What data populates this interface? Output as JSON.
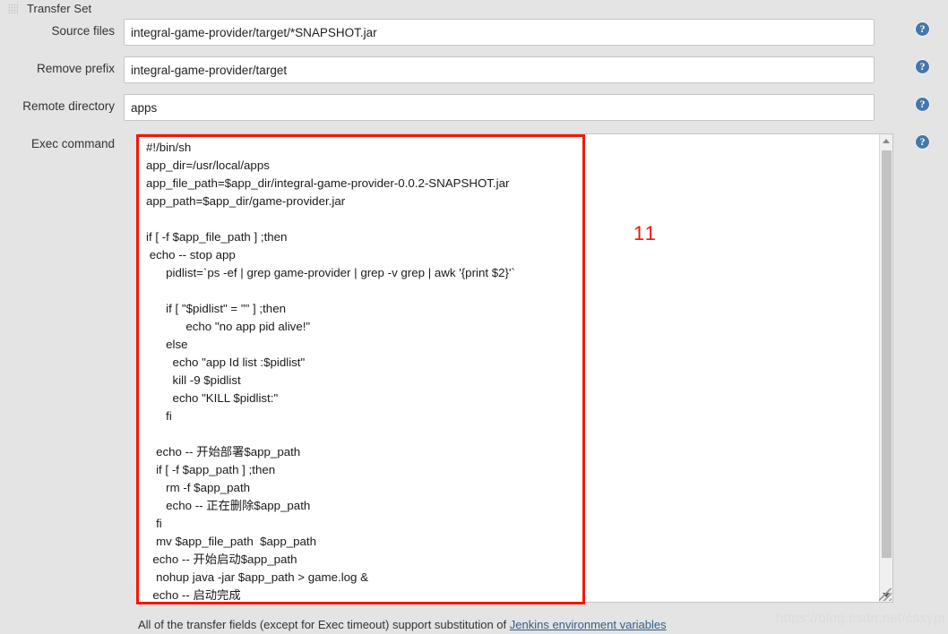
{
  "panel": {
    "title": "Transfer Set",
    "grip_icon": "drag-grip-icon"
  },
  "fields": [
    {
      "label": "Source files",
      "value": "integral-game-provider/target/*SNAPSHOT.jar",
      "help_icon": "help-circle-icon"
    },
    {
      "label": "Remove prefix",
      "value": "integral-game-provider/target",
      "help_icon": "help-circle-icon"
    },
    {
      "label": "Remote directory",
      "value": "apps",
      "help_icon": "help-circle-icon"
    },
    {
      "label": "Exec command",
      "help_icon": "help-circle-icon"
    }
  ],
  "exec_command": {
    "label": "Exec command",
    "value": "#!/bin/sh\napp_dir=/usr/local/apps\napp_file_path=$app_dir/integral-game-provider-0.0.2-SNAPSHOT.jar\napp_path=$app_dir/game-provider.jar\n\nif [ -f $app_file_path ] ;then\n echo -- stop app\n      pidlist=`ps -ef | grep game-provider | grep -v grep | awk '{print $2}'`\n\n      if [ \"$pidlist\" = \"\" ] ;then\n            echo \"no app pid alive!\"\n      else\n        echo \"app Id list :$pidlist\"\n        kill -9 $pidlist\n        echo \"KILL $pidlist:\"\n      fi\n\n   echo -- 开始部署$app_path\n   if [ -f $app_path ] ;then\n      rm -f $app_path\n      echo -- 正在删除$app_path\n   fi\n   mv $app_file_path  $app_path\n  echo -- 开始启动$app_path\n   nohup java -jar $app_path > game.log &\n  echo -- 启动完成\nfi",
    "scrollbar": {
      "up_arrow_icon": "chevron-up-icon",
      "down_arrow_icon": "chevron-down-icon"
    },
    "resize_icon": "resize-grip-icon"
  },
  "annotation": {
    "number": "11",
    "color": "#fa1405"
  },
  "footer": {
    "note_prefix": "All of the transfer fields (except for Exec timeout) support substitution of ",
    "link_text": "Jenkins environment variables"
  },
  "watermark": {
    "text": "https://blog.csdn.net/csxypr"
  },
  "colors": {
    "background": "#e4e4e4",
    "field_background": "#ffffff",
    "field_border": "#c6c6c6",
    "help_icon": "#4477aa",
    "link": "#325d88",
    "annotation": "#fa1405"
  }
}
